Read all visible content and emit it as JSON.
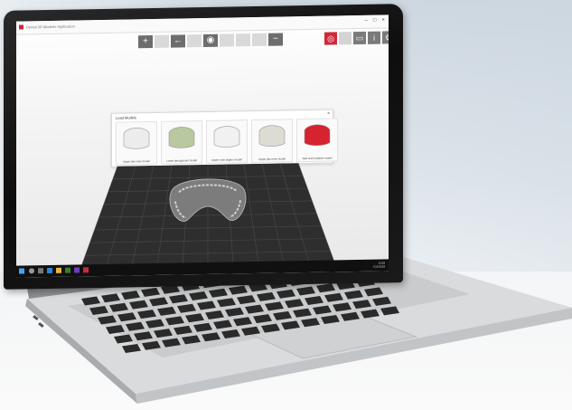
{
  "window": {
    "title": "Dental 3D Modeler Application",
    "controls": [
      "–",
      "□",
      "×"
    ]
  },
  "toolbar": {
    "buttons": [
      {
        "name": "add-icon",
        "glyph": "+"
      },
      {
        "name": "blank-icon",
        "glyph": ""
      },
      {
        "name": "back-arrow-icon",
        "glyph": "←"
      },
      {
        "name": "blank-icon",
        "glyph": ""
      },
      {
        "name": "eye-icon",
        "glyph": "◉"
      },
      {
        "name": "blank-icon",
        "glyph": ""
      },
      {
        "name": "blank-icon",
        "glyph": ""
      },
      {
        "name": "blank-icon",
        "glyph": ""
      },
      {
        "name": "minus-icon",
        "glyph": "−"
      }
    ],
    "right": [
      {
        "name": "model-red-icon",
        "glyph": "◎"
      },
      {
        "name": "blank-icon",
        "glyph": ""
      },
      {
        "name": "folder-icon",
        "glyph": "▭"
      },
      {
        "name": "info-icon",
        "glyph": "i"
      },
      {
        "name": "gear-icon",
        "glyph": "⚙"
      }
    ]
  },
  "picker": {
    "title": "Load Models",
    "close": "×",
    "tiles": [
      {
        "label": "Upper jaw scan model",
        "color": "#ececec"
      },
      {
        "label": "Lower jaw gypsum model",
        "color": "#b9c8a0"
      },
      {
        "label": "Upper arch aligner model",
        "color": "#f1f1f1"
      },
      {
        "label": "Upper jaw resin model",
        "color": "#dddcd4"
      },
      {
        "label": "Red resin retainer model",
        "color": "#d5232f"
      }
    ]
  },
  "taskbar": {
    "clock": "13:58",
    "date": "7/14/2018"
  }
}
